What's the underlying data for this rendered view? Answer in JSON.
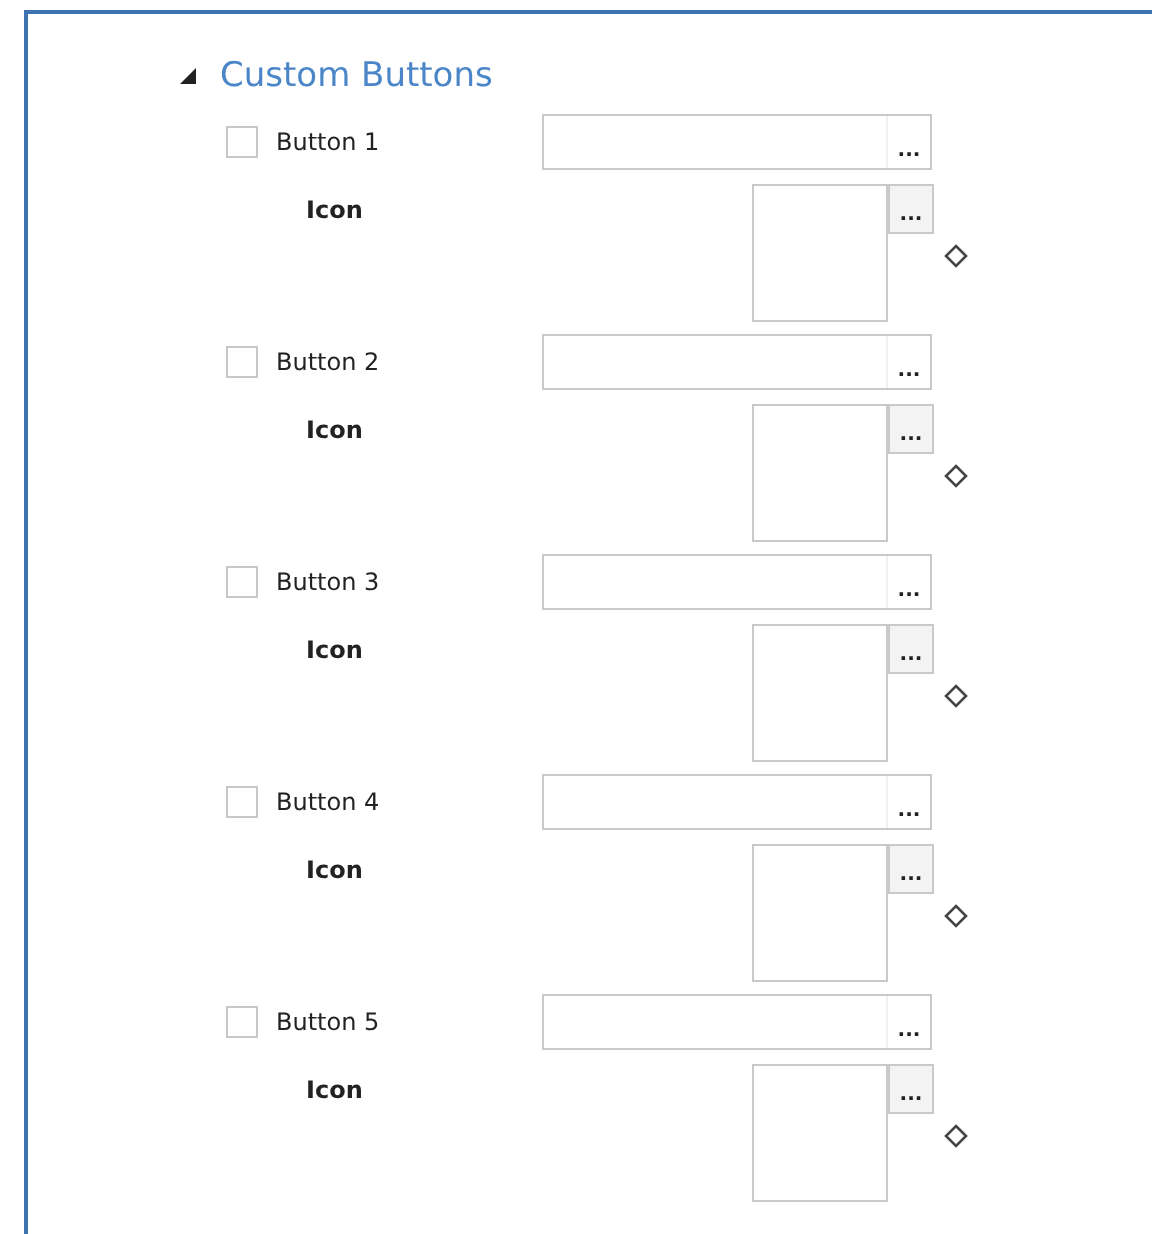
{
  "section": {
    "title": "Custom Buttons",
    "expanded": true
  },
  "buttons": [
    {
      "label": "Button 1",
      "checked": false,
      "browse": "...",
      "icon_label": "Icon",
      "icon_browse": "..."
    },
    {
      "label": "Button 2",
      "checked": false,
      "browse": "...",
      "icon_label": "Icon",
      "icon_browse": "..."
    },
    {
      "label": "Button 3",
      "checked": false,
      "browse": "...",
      "icon_label": "Icon",
      "icon_browse": "..."
    },
    {
      "label": "Button 4",
      "checked": false,
      "browse": "...",
      "icon_label": "Icon",
      "icon_browse": "..."
    },
    {
      "label": "Button 5",
      "checked": false,
      "browse": "...",
      "icon_label": "Icon",
      "icon_browse": "..."
    }
  ]
}
